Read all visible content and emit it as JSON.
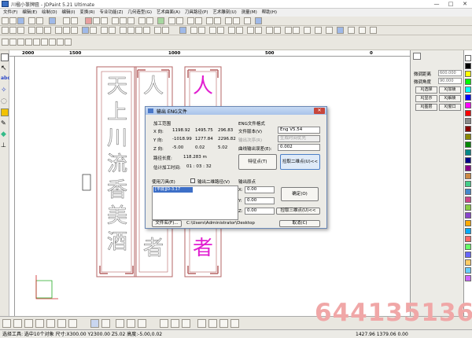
{
  "window": {
    "title": "川楹小篆牌匾 - JDPaint 5.21 Ultimate",
    "min": "—",
    "max": "□",
    "close": "✕"
  },
  "menu": [
    "文件(F)",
    "编辑(E)",
    "绘制(D)",
    "编辑(I)",
    "变换(R)",
    "专业功能(Z)",
    "几何造型(G)",
    "艺术曲面(A)",
    "刀具路径(P)",
    "艺术雕刻(U)",
    "测量(M)",
    "帮助(H)"
  ],
  "ruler": [
    "2000",
    "1500",
    "1000",
    "500",
    "0"
  ],
  "panel": {
    "spacing_label": "微调距离",
    "spacing_value": "600.000",
    "angle_label": "微调角度",
    "angle_value": "90.000",
    "btn1": "X|选择",
    "btn2": "X|加锁",
    "btn3": "X|显示",
    "btn4": "X|解锁",
    "btn5": "X|图层",
    "btn6": "X|窗口"
  },
  "canvas": {
    "col1": [
      "天",
      "上",
      "川",
      "流",
      "香",
      "美",
      "酒"
    ],
    "col2_top": "人",
    "col2_bottom": "者",
    "col3_top": "人",
    "col3_bottom": "者"
  },
  "dialog": {
    "title": "输出 ENG文件",
    "range_label": "加工范围",
    "x_label": "X 向:",
    "x_min": "1198.92",
    "x_max": "1495.75",
    "x_size": "296.83",
    "y_label": "Y 向:",
    "y_min": "-1018.99",
    "y_max": "1277.84",
    "y_size": "2296.82",
    "z_label": "Z 向:",
    "z_min": "-5.00",
    "z_max": "0.02",
    "z_size": "5.02",
    "path_len_label": "路径长度:",
    "path_len_value": "118.283 m",
    "time_label": "估计加工时间:",
    "time_value": "01 : 03 : 32",
    "fmt_label": "ENG文件格式",
    "ver_label": "文件版本(V)",
    "ver_value": "Eng V5.54",
    "sort_label": "输出次序(R)",
    "sort_value": "生成时间优先",
    "curve_label": "曲线输出误差(E):",
    "curve_value": "0.002",
    "feature_btn": "特征点(T)",
    "assist_btn": "捡取二维点(U)<<",
    "tools_label": "使用刀具(E)",
    "chk_label": "输出二维路径(V)",
    "tool_item": "[平底]JD-3.17",
    "origin_label": "输出原点",
    "ox_label": "X:",
    "ox_value": "0.00",
    "oy_label": "Y:",
    "oy_value": "0.00",
    "oz_label": "Z:",
    "oz_value": "0.00",
    "ok_btn": "确定(O)",
    "pick_btn": "捡取三维点(U)<<",
    "filename_btn": "文件名(F)...",
    "path_value": "C:\\Users\\Administrator\\Desktop",
    "cancel_btn": "取消(C)"
  },
  "status": {
    "text": "选择工具: 选中10个对象 尺寸:X300.00 Y2300.00 Z5.02 高度:-5.00,0.02",
    "coords": "1427.96    1379.06    0.00"
  },
  "watermark": "644135136",
  "colors": {
    "pink": "#e11fd0",
    "frame": "#b66464",
    "accent": "#3d6fc7"
  }
}
